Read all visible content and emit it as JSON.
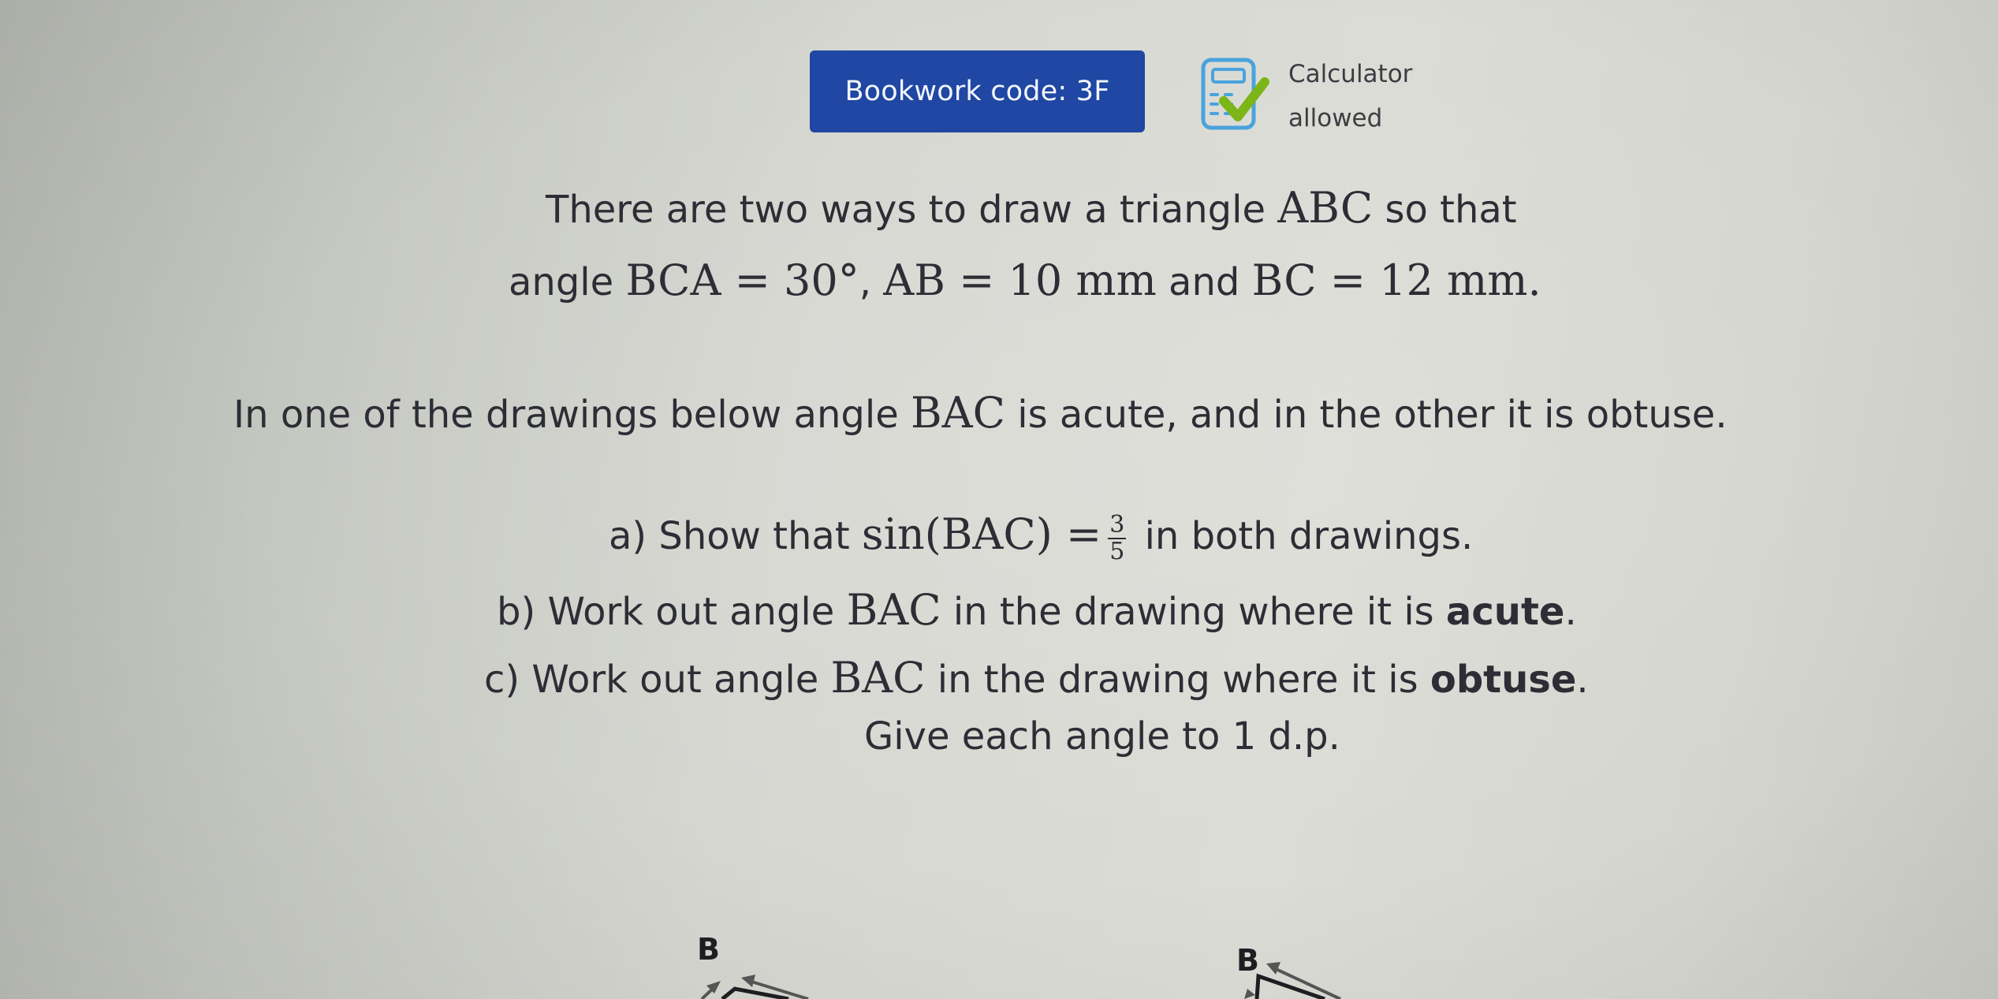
{
  "header": {
    "bookwork_code_label": "Bookwork code: 3F",
    "calculator_icon": "calculator-check-icon",
    "calculator_line1": "Calculator",
    "calculator_line2": "allowed"
  },
  "colors": {
    "bookwork_bg": "#1f47a3",
    "calculator_icon": "#4aa3dd",
    "check_mark": "#7cb518"
  },
  "question": {
    "intro": {
      "l1_a": "There are two ways to draw a triangle ",
      "l1_m": "ABC",
      "l1_b": " so that",
      "l2_a": "angle ",
      "l2_m1": "BCA = 30°",
      "l2_sep": ", ",
      "l2_m2": "AB = 10 mm",
      "l2_and": " and ",
      "l2_m3": "BC = 12 mm."
    },
    "context": {
      "a": "In one of the drawings below angle ",
      "m": "BAC",
      "b": " is acute, and in the other it is obtuse."
    },
    "parts": {
      "a_prefix": "a) Show that ",
      "a_math": "sin(BAC) =",
      "a_num": "3",
      "a_den": "5",
      "a_suffix": " in both drawings.",
      "b_prefix": "b) Work out angle ",
      "b_math": "BAC",
      "b_mid": " in the drawing where it is ",
      "b_bold": "acute",
      "b_end": ".",
      "c_prefix": "c) Work out angle ",
      "c_math": "BAC",
      "c_mid": " in the drawing where it is ",
      "c_bold": "obtuse",
      "c_end": "."
    },
    "instruction": "Give each angle to 1 d.p."
  },
  "diagrams": [
    {
      "vertex_label": "B"
    },
    {
      "vertex_label": "B"
    }
  ]
}
